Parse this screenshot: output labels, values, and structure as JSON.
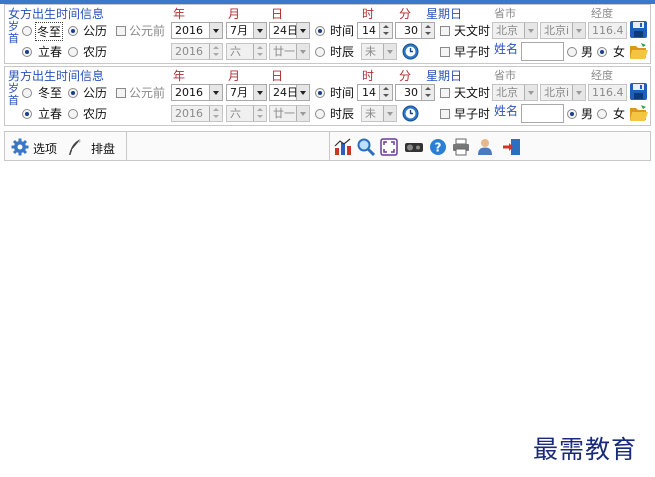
{
  "window": {
    "accent": "#3a78c8"
  },
  "common": {
    "year_header": "年",
    "month_header": "月",
    "day_header": "日",
    "hour_header": "时",
    "minute_header": "分",
    "weekday_header": "星期日",
    "province_header": "省市",
    "longitude_header": "经度",
    "age_label_1": "岁",
    "age_label_2": "首",
    "dongzhi": "冬至",
    "lichun": "立春",
    "solar": "公历",
    "lunar": "农历",
    "bc": "公元前",
    "time_label": "时间",
    "shichen_label": "时辰",
    "astro_label": "天文时",
    "zaozi_label": "早子时",
    "name_label": "姓名",
    "male": "男",
    "female": "女"
  },
  "female": {
    "section_title": "女方出生时间信息",
    "year": "2016",
    "month": "7月",
    "day": "24日",
    "hour": "14",
    "minute": "30",
    "lunar_year": "2016",
    "lunar_month": "六",
    "lunar_day": "廿一",
    "shichen": "未",
    "province": "北京",
    "city": "北京i",
    "longitude": "116.4",
    "name": "",
    "solar_selected": true,
    "lichun_selected": true,
    "time_selected": true,
    "gender": "female"
  },
  "male": {
    "section_title": "男方出生时间信息",
    "year": "2016",
    "month": "7月",
    "day": "24日",
    "hour": "14",
    "minute": "30",
    "lunar_year": "2016",
    "lunar_month": "六",
    "lunar_day": "廿一",
    "shichen": "未",
    "province": "北京",
    "city": "北京i",
    "longitude": "116.4",
    "name": "",
    "solar_selected": true,
    "lichun_selected": true,
    "time_selected": true,
    "gender": "male"
  },
  "toolbar": {
    "options_label": "选项",
    "arrange_label": "排盘",
    "icons": [
      "chart-icon",
      "zoom-icon",
      "fullscreen-icon",
      "projector-icon",
      "help-icon",
      "print-icon",
      "user-icon",
      "exit-icon"
    ]
  },
  "watermark": {
    "text": "最需教育"
  }
}
